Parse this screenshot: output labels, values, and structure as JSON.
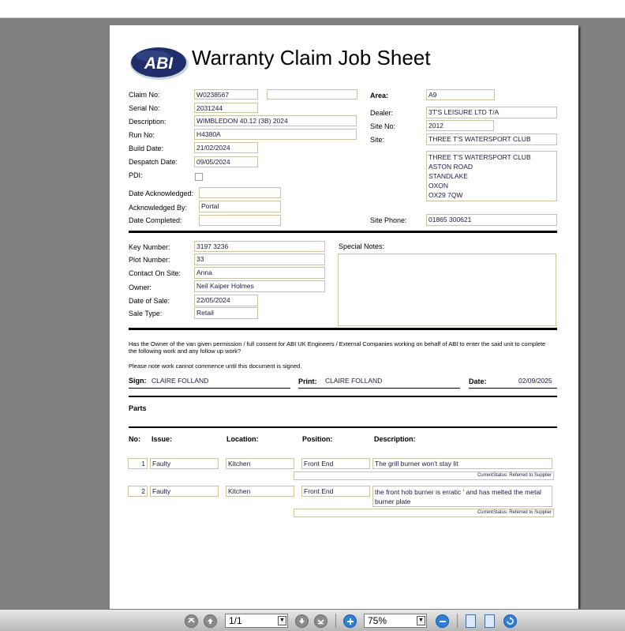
{
  "title": "Warranty Claim Job Sheet",
  "logo_text": "ABI",
  "header_left": [
    {
      "label": "Claim No:",
      "value": "W0238567"
    },
    {
      "label": "Serial No:",
      "value": "2031244"
    },
    {
      "label": "Description:",
      "value": "WIMBLEDON 40.12 (3B) 2024"
    },
    {
      "label": "Run No:",
      "value": "H4380A"
    },
    {
      "label": "Build Date:",
      "value": "21/02/2024"
    },
    {
      "label": "Despatch Date:",
      "value": "09/05/2024"
    },
    {
      "label": "PDI:",
      "value": ""
    },
    {
      "label": "Date Acknowledged:",
      "value": ""
    },
    {
      "label": "Acknowledged By:",
      "value": "Portal"
    },
    {
      "label": "Date Completed:",
      "value": ""
    }
  ],
  "header_right": {
    "area_label": "Area:",
    "area": "A9",
    "dealer_label": "Dealer:",
    "dealer": "3T'S LEISURE LTD T/A",
    "site_no_label": "Site No:",
    "site_no": "2012",
    "site_label": "Site:",
    "site": "THREE T'S WATERSPORT CLUB",
    "address": "THREE T'S WATERSPORT CLUB\nASTON ROAD\nSTANDLAKE\nOXON\nOX29 7QW",
    "site_phone_label": "Site Phone:",
    "site_phone": "01865 300621"
  },
  "owner_block": [
    {
      "label": "Key Number:",
      "value": "3197 3236"
    },
    {
      "label": "Plot Number:",
      "value": "33"
    },
    {
      "label": "Contact On Site:",
      "value": "Anna"
    },
    {
      "label": "Owner:",
      "value": "Neil Kaiper Holmes"
    },
    {
      "label": "Date of Sale:",
      "value": "22/05/2024"
    },
    {
      "label": "Sale Type:",
      "value": "Retail"
    }
  ],
  "special_notes_label": "Special Notes:",
  "special_notes": "",
  "consent": {
    "text": "Has the Owner of the van given permission / full consent for ABI UK Engineers / External Companies working on behalf of ABI to enter the said unit to complete the following work and any follow up work?",
    "note": "Please note work cannot commence until this document is signed.",
    "sign_label": "Sign:",
    "sign": "CLAIRE FOLLAND",
    "print_label": "Print:",
    "print": "CLAIRE FOLLAND",
    "date_label": "Date:",
    "date": "02/09/2025"
  },
  "parts": {
    "heading": "Parts",
    "columns": [
      "No:",
      "Issue:",
      "Location:",
      "Position:",
      "Description:"
    ],
    "rows": [
      {
        "no": "1",
        "issue": "Faulty",
        "location": "Kitchen",
        "position": "Front End",
        "description": "The grill burner won't stay lit",
        "status": "CurrentStatus: Referred to Supplier"
      },
      {
        "no": "2",
        "issue": "Faulty",
        "location": "Kitchen",
        "position": "Front End",
        "description": "the front hob burner is erratic ' and has melted the metal burner plate",
        "status": "CurrentStatus: Referred to Supplier"
      }
    ]
  },
  "toolbar": {
    "page": "1/1",
    "zoom": "75%"
  },
  "colors": {
    "field_border": "#c9c3a3",
    "logo_blue": "#1f2d6b",
    "toolbar_blue": "#2e7fd6"
  }
}
